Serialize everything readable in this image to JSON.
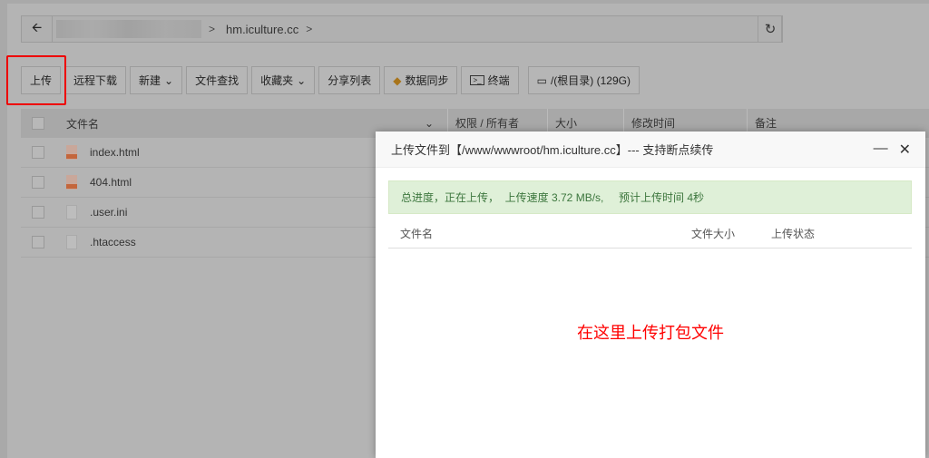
{
  "nav": {
    "path": "hm.iculture.cc",
    "sep": ">"
  },
  "toolbar": {
    "upload": "上传",
    "remote_download": "远程下载",
    "new": "新建",
    "find": "文件查找",
    "favorites": "收藏夹",
    "share_list": "分享列表",
    "sync": "数据同步",
    "terminal": "终端",
    "disk": "/(根目录) (129G)"
  },
  "table": {
    "headers": [
      "文件名",
      "权限 / 所有者",
      "大小",
      "修改时间",
      "备注"
    ],
    "files": [
      {
        "name": "index.html",
        "type": "html"
      },
      {
        "name": "404.html",
        "type": "html"
      },
      {
        "name": ".user.ini",
        "type": "txt"
      },
      {
        "name": ".htaccess",
        "type": "txt"
      }
    ]
  },
  "dialog": {
    "title": "上传文件到【/www/wwwroot/hm.iculture.cc】--- 支持断点续传",
    "progress": "总进度，正在上传，  上传速度 3.72 MB/s,     预计上传时间 4秒",
    "headers": [
      "文件名",
      "文件大小",
      "上传状态"
    ],
    "hint": "在这里上传打包文件"
  },
  "colors": {
    "highlight": "#ee0000",
    "success_bg": "#dff0d8",
    "hint": "#ff0000"
  }
}
